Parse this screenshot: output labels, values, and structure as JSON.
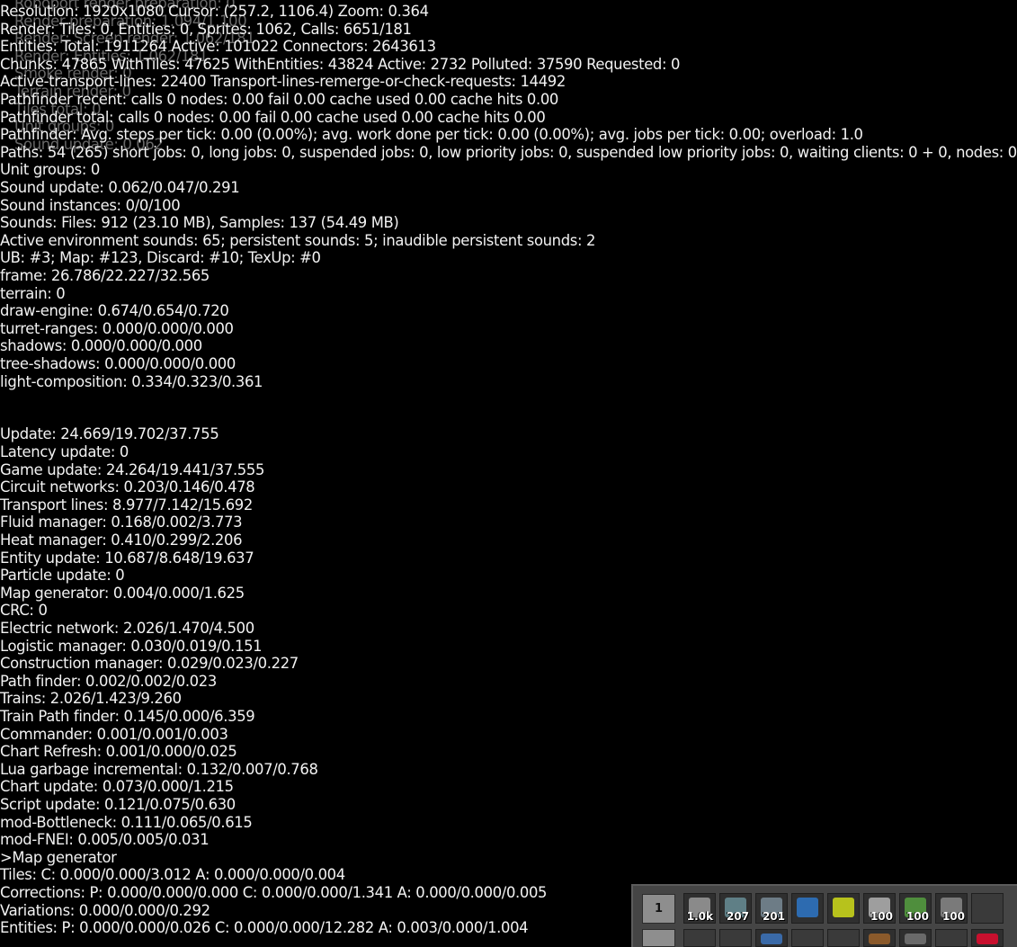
{
  "debug_lines": [
    "Resolution: 1920x1080 Cursor: (257.2, 1106.4) Zoom: 0.364",
    "Render: Tiles: 0, Entities: 0, Sprites: 1062, Calls: 6651/181",
    "Entities: Total: 1911264 Active: 101022 Connectors: 2643613",
    "Chunks: 47865 WithTiles: 47625 WithEntities: 43824 Active: 2732 Polluted: 37590 Requested: 0",
    "Active-transport-lines: 22400 Transport-lines-remerge-or-check-requests: 14492",
    "Pathfinder recent: calls 0 nodes: 0.00 fail 0.00 cache used 0.00 cache hits 0.00",
    "Pathfinder total: calls 0 nodes: 0.00 fail 0.00 cache used 0.00 cache hits 0.00",
    "Pathfinder: Avg. steps per tick: 0.00 (0.00%); avg. work done per tick: 0.00 (0.00%); avg. jobs per tick: 0.00; overload: 1.0",
    "Paths: 54 (265) short jobs: 0, long jobs: 0, suspended jobs: 0, low priority jobs: 0, suspended low priority jobs: 0, waiting clients: 0 + 0, nodes: 0 + 0",
    "Unit groups: 0",
    "Sound update: 0.062/0.047/0.291",
    "Sound instances: 0/0/100",
    "Sounds: Files: 912 (23.10 MB), Samples: 137 (54.49 MB)",
    "Active environment sounds: 65; persistent sounds: 5; inaudible persistent sounds: 2",
    "UB: #3; Map: #123, Discard: #10; TexUp: #0",
    "frame: 26.786/22.227/32.565",
    "terrain: 0",
    "draw-engine: 0.674/0.654/0.720",
    "turret-ranges: 0.000/0.000/0.000",
    "shadows: 0.000/0.000/0.000",
    "tree-shadows: 0.000/0.000/0.000",
    "light-composition: 0.334/0.323/0.361",
    "",
    "",
    "Update: 24.669/19.702/37.755",
    "    Latency update: 0",
    "    Game update: 24.264/19.441/37.555",
    "      Circuit networks: 0.203/0.146/0.478",
    "      Transport lines: 8.977/7.142/15.692",
    "      Fluid manager: 0.168/0.002/3.773",
    "      Heat manager: 0.410/0.299/2.206",
    "      Entity update: 10.687/8.648/19.637",
    "      Particle update: 0",
    "      Map generator: 0.004/0.000/1.625",
    "      CRC: 0",
    "      Electric network: 2.026/1.470/4.500",
    "      Logistic manager: 0.030/0.019/0.151",
    "      Construction manager: 0.029/0.023/0.227",
    "      Path finder: 0.002/0.002/0.023",
    "      Trains: 2.026/1.423/9.260",
    "        Train Path finder: 0.145/0.000/6.359",
    "      Commander: 0.001/0.001/0.003",
    "      Chart Refresh: 0.001/0.000/0.025",
    "    Lua garbage incremental: 0.132/0.007/0.768",
    "    Chart update: 0.073/0.000/1.215",
    "    Script update: 0.121/0.075/0.630",
    "      mod-Bottleneck: 0.111/0.065/0.615",
    "      mod-FNEI: 0.005/0.005/0.031",
    ">Map generator",
    "    Tiles: C: 0.000/0.000/3.012 A: 0.000/0.000/0.004",
    "    Corrections: P: 0.000/0.000/0.000 C: 0.000/0.000/1.341 A: 0.000/0.000/0.005",
    "    Variations: 0.000/0.000/0.292",
    "    Entities: P: 0.000/0.000/0.026 C: 0.000/0.000/12.282 A: 0.003/0.000/1.004"
  ],
  "ghost_lines": [
    "Roboport render preparation: 0",
    "Render preparation: 1.094/1.100",
    "Render: Screen render: 1.062/181",
    "Render: Entities: 1.062/181",
    "Smoke render: 0",
    "Terrain render: 0",
    "Tiles total: 0",
    "Unit groups: 0",
    "Sound update: 0.062"
  ],
  "quickbar": {
    "row1_label": "1",
    "row2_label": "",
    "slots": [
      {
        "icon": "stone-wall-icon",
        "count": "1.0k",
        "color": "#8a8a8a"
      },
      {
        "icon": "radar-icon",
        "count": "207",
        "color": "#5f7f86"
      },
      {
        "icon": "substation-icon",
        "count": "201",
        "color": "#6d7c86"
      },
      {
        "icon": "rail-signal-icon",
        "count": "",
        "color": "#2d6bb0"
      },
      {
        "icon": "module-icon",
        "count": "",
        "color": "#b7c21c"
      },
      {
        "icon": "repair-pack-icon",
        "count": "100",
        "color": "#9e9e9e"
      },
      {
        "icon": "tree-seed-icon",
        "count": "100",
        "color": "#4f8e3d"
      },
      {
        "icon": "drone-icon",
        "count": "100",
        "color": "#7a7a7a"
      },
      {
        "icon": "empty-slot-icon",
        "count": "",
        "color": "#2f2f2f"
      }
    ],
    "row2_slots": [
      {
        "icon": "empty-slot-icon",
        "color": "#2f2f2f"
      },
      {
        "icon": "empty-slot-icon",
        "color": "#2f2f2f"
      },
      {
        "icon": "blueprint-icon",
        "color": "#3a6aa8"
      },
      {
        "icon": "empty-slot-icon",
        "color": "#2f2f2f"
      },
      {
        "icon": "empty-slot-icon",
        "color": "#2f2f2f"
      },
      {
        "icon": "item-icon",
        "color": "#8b5a2b"
      },
      {
        "icon": "item-icon",
        "color": "#6a6a6a"
      },
      {
        "icon": "empty-slot-icon",
        "color": "#2f2f2f"
      },
      {
        "icon": "red-item-icon",
        "color": "#c8102e"
      }
    ]
  }
}
